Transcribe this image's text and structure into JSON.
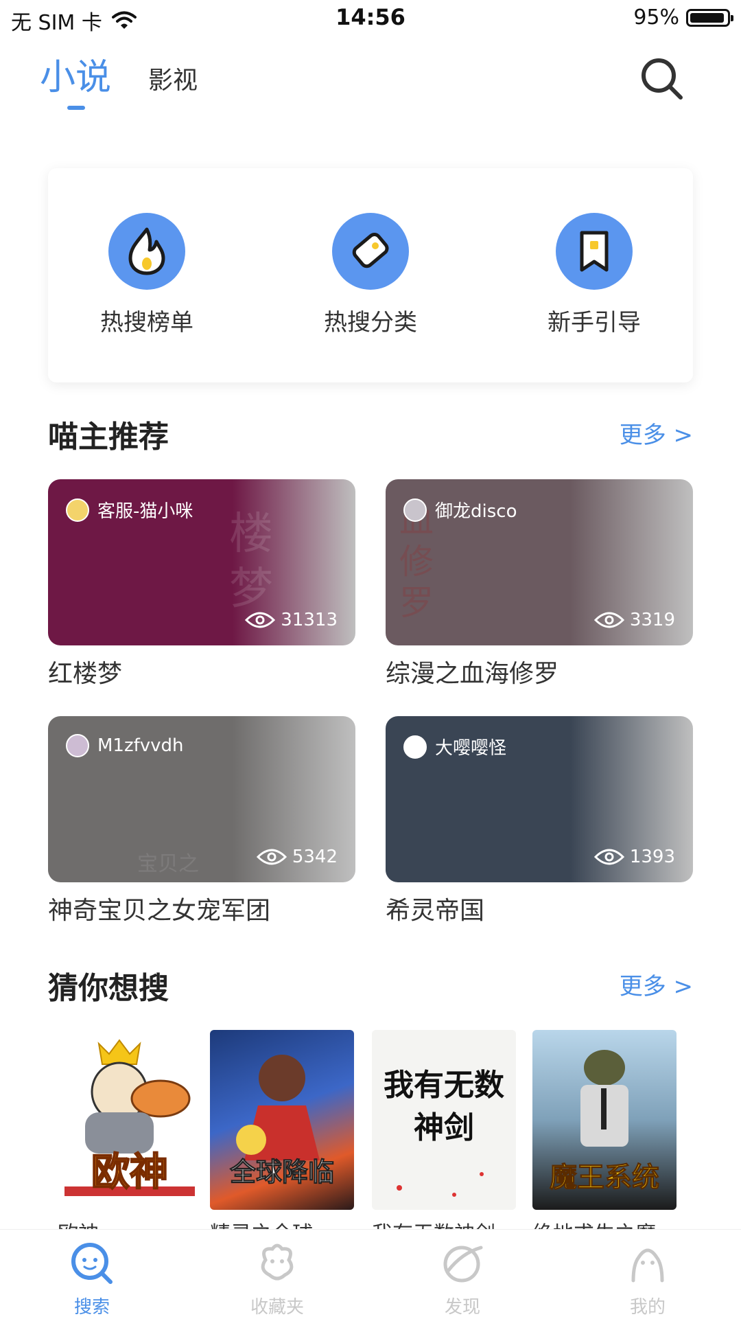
{
  "status_bar": {
    "carrier": "无 SIM 卡",
    "time": "14:56",
    "battery": "95%",
    "battery_level": 0.95
  },
  "top_tabs": {
    "novel": "小说",
    "video": "影视"
  },
  "quick_actions": [
    {
      "label": "热搜榜单",
      "icon": "flame-icon"
    },
    {
      "label": "热搜分类",
      "icon": "tag-icon"
    },
    {
      "label": "新手引导",
      "icon": "bookmark-icon"
    }
  ],
  "recommend": {
    "title": "喵主推荐",
    "more": "更多 >",
    "items": [
      {
        "user": "客服-猫小咪",
        "views": "31313",
        "title": "红楼梦",
        "color": "#6e1845"
      },
      {
        "user": "御龙disco",
        "views": "3319",
        "title": "综漫之血海修罗",
        "color": "#6b5a60"
      },
      {
        "user": "M1zfvvdh",
        "views": "5342",
        "title": "神奇宝贝之女宠军团",
        "color": "#6f6d6c"
      },
      {
        "user": "大嘤嘤怪",
        "views": "1393",
        "title": "希灵帝国",
        "color": "#3a4554"
      }
    ]
  },
  "guess": {
    "title": "猜你想搜",
    "more": "更多 >",
    "books": [
      {
        "title": "欧神",
        "cover_text": "欧神"
      },
      {
        "title": "精灵之全球...",
        "cover_text": "全球降临"
      },
      {
        "title": "我有无数神剑",
        "cover_text": "我有无数神剑"
      },
      {
        "title": "绝地求生之魔...",
        "cover_text": "魔王系统"
      }
    ]
  },
  "bottom_nav": [
    {
      "label": "搜索",
      "active": true
    },
    {
      "label": "收藏夹",
      "active": false
    },
    {
      "label": "发现",
      "active": false
    },
    {
      "label": "我的",
      "active": false
    }
  ]
}
